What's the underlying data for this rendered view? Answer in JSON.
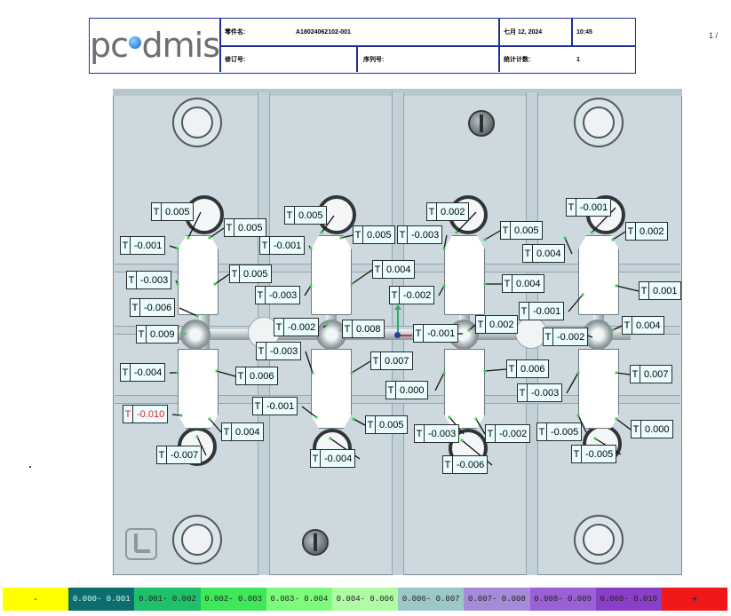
{
  "header": {
    "logo_text": "pc dmis",
    "part_name_label": "零件名:",
    "part_name_value": "A18024062102-001",
    "date": "七月 12, 2024",
    "time": "10:45",
    "revision_label": "修订号:",
    "serial_label": "序列号:",
    "stat_count_label": "统计计数:",
    "stat_count_value": "1"
  },
  "page_number": "1 /",
  "tolerance_colors": {
    "in_tolerance_text": "#000000",
    "out_of_tolerance_text": "#e02020",
    "tag_fill": "#eafdfe"
  },
  "callouts": [
    {
      "label": "T",
      "value": "0.005"
    },
    {
      "label": "T",
      "value": "0.005"
    },
    {
      "label": "T",
      "value": "-0.001"
    },
    {
      "label": "T",
      "value": "-0.003"
    },
    {
      "label": "T",
      "value": "0.005"
    },
    {
      "label": "T",
      "value": "-0.006"
    },
    {
      "label": "T",
      "value": "0.009"
    },
    {
      "label": "T",
      "value": "-0.004"
    },
    {
      "label": "T",
      "value": "-0.010"
    },
    {
      "label": "T",
      "value": "0.004"
    },
    {
      "label": "T",
      "value": "-0.007"
    },
    {
      "label": "T",
      "value": "0.006"
    },
    {
      "label": "T",
      "value": "0.005"
    },
    {
      "label": "T",
      "value": "-0.001"
    },
    {
      "label": "T",
      "value": "0.005"
    },
    {
      "label": "T",
      "value": "-0.003"
    },
    {
      "label": "T",
      "value": "0.004"
    },
    {
      "label": "T",
      "value": "-0.002"
    },
    {
      "label": "T",
      "value": "0.008"
    },
    {
      "label": "T",
      "value": "-0.003"
    },
    {
      "label": "T",
      "value": "0.007"
    },
    {
      "label": "T",
      "value": "-0.001"
    },
    {
      "label": "T",
      "value": "0.005"
    },
    {
      "label": "T",
      "value": "-0.004"
    },
    {
      "label": "T",
      "value": "0.002"
    },
    {
      "label": "T",
      "value": "-0.003"
    },
    {
      "label": "T",
      "value": "0.005"
    },
    {
      "label": "T",
      "value": "0.004"
    },
    {
      "label": "T",
      "value": "-0.002"
    },
    {
      "label": "T",
      "value": "0.004"
    },
    {
      "label": "T",
      "value": "-0.001"
    },
    {
      "label": "T",
      "value": "0.002"
    },
    {
      "label": "T",
      "value": "0.006"
    },
    {
      "label": "T",
      "value": "0.000"
    },
    {
      "label": "T",
      "value": "-0.003"
    },
    {
      "label": "T",
      "value": "-0.002"
    },
    {
      "label": "T",
      "value": "-0.006"
    },
    {
      "label": "T",
      "value": "-0.001"
    },
    {
      "label": "T",
      "value": "0.002"
    },
    {
      "label": "T",
      "value": "0.001"
    },
    {
      "label": "T",
      "value": "-0.001"
    },
    {
      "label": "T",
      "value": "-0.002"
    },
    {
      "label": "T",
      "value": "0.004"
    },
    {
      "label": "T",
      "value": "0.007"
    },
    {
      "label": "T",
      "value": "-0.003"
    },
    {
      "label": "T",
      "value": "-0.005"
    },
    {
      "label": "T",
      "value": "0.000"
    },
    {
      "label": "T",
      "value": "-0.005"
    }
  ],
  "legend": [
    {
      "text": "-",
      "color": "#ffff00"
    },
    {
      "text": "0.000- 0.001",
      "color": "#0e6b6e"
    },
    {
      "text": "0.001- 0.002",
      "color": "#1fc06a"
    },
    {
      "text": "0.002- 0.003",
      "color": "#3ee85a"
    },
    {
      "text": "0.003- 0.004",
      "color": "#7dfb7a"
    },
    {
      "text": "0.004- 0.006",
      "color": "#b0fba6"
    },
    {
      "text": "0.006- 0.007",
      "color": "#9bc7c9"
    },
    {
      "text": "0.007- 0.008",
      "color": "#a68bd8"
    },
    {
      "text": "0.008- 0.009",
      "color": "#9b5fd6"
    },
    {
      "text": "0.009- 0.010",
      "color": "#8a3fc9"
    },
    {
      "text": "+",
      "color": "#f01818"
    }
  ]
}
